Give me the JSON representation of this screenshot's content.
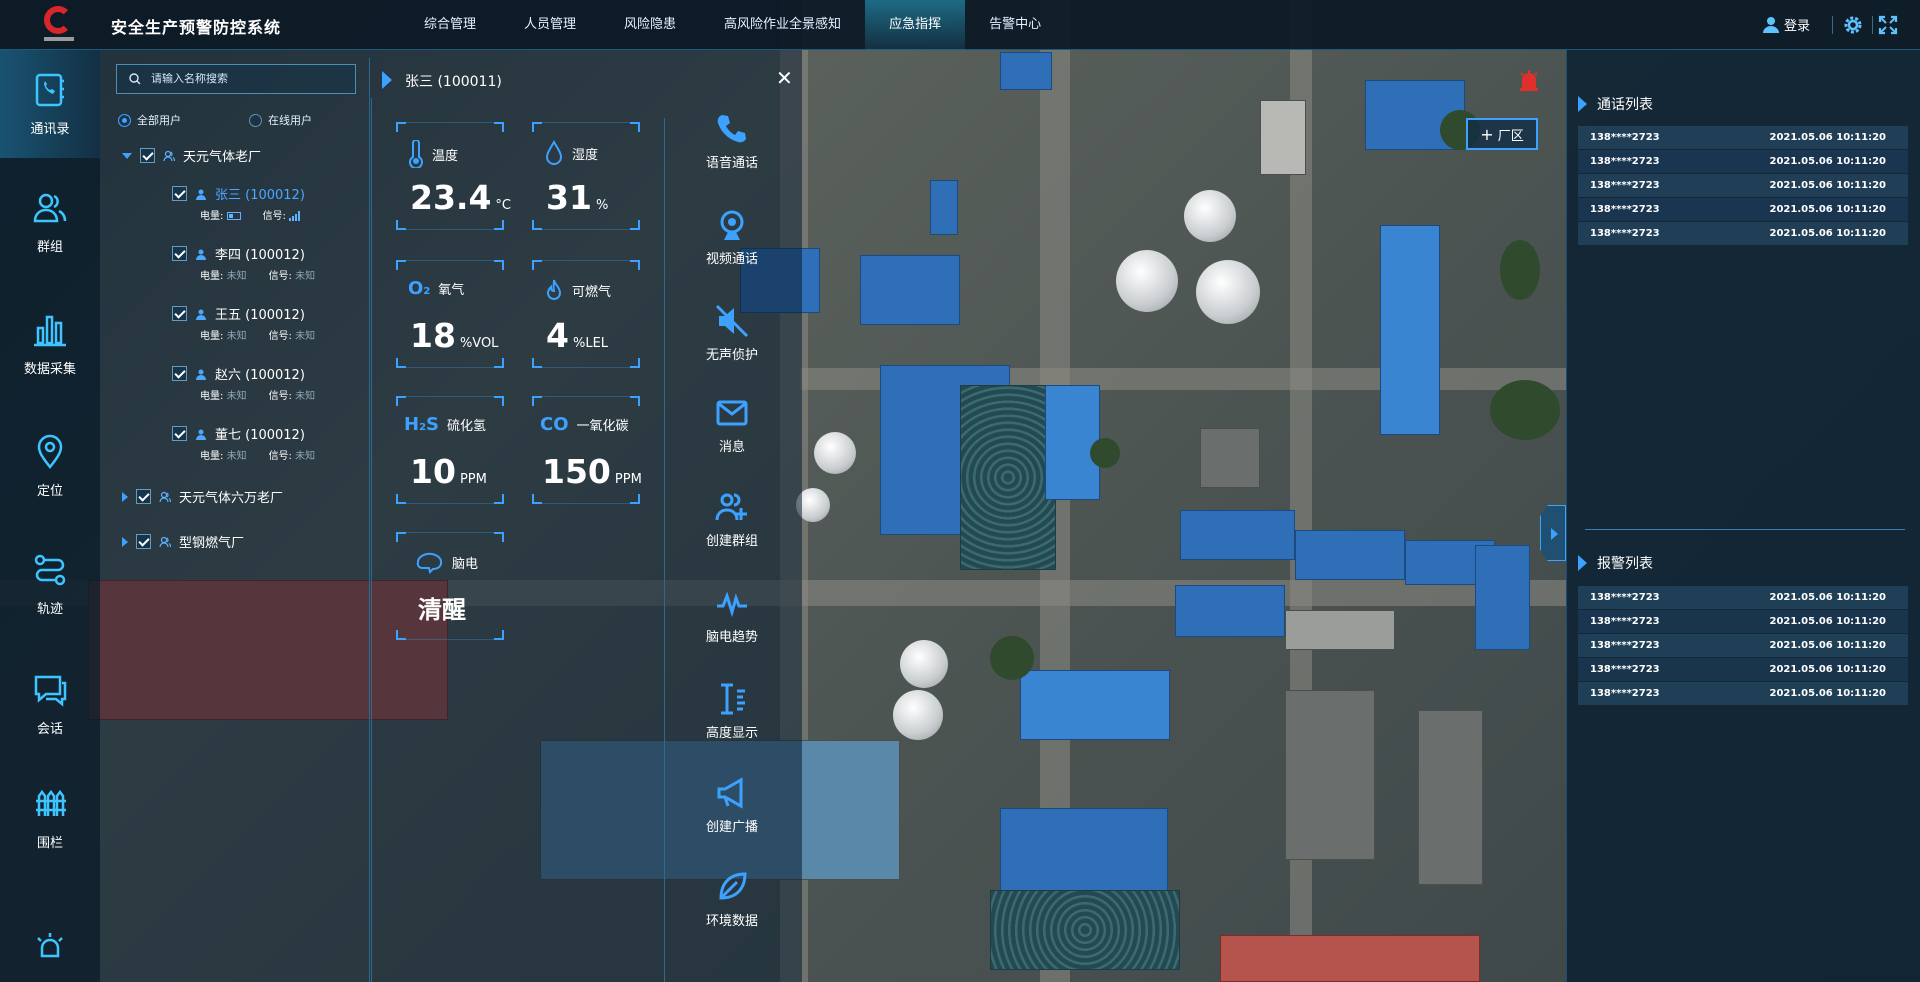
{
  "app": {
    "title": "安全生产预警防控系统"
  },
  "nav": [
    {
      "label": "综合管理"
    },
    {
      "label": "人员管理"
    },
    {
      "label": "风险隐患"
    },
    {
      "label": "高风险作业全景感知"
    },
    {
      "label": "应急指挥",
      "active": true
    },
    {
      "label": "告警中心"
    }
  ],
  "topright": {
    "login_label": "登录",
    "icons": [
      "user-icon",
      "gear-icon",
      "fullscreen-icon"
    ]
  },
  "sidebar": {
    "items": [
      {
        "label": "通讯录",
        "icon": "phonebook-icon",
        "active": true
      },
      {
        "label": "群组",
        "icon": "group-icon"
      },
      {
        "label": "数据采集",
        "icon": "bar-chart-icon"
      },
      {
        "label": "定位",
        "icon": "location-pin-icon"
      },
      {
        "label": "轨迹",
        "icon": "route-icon"
      },
      {
        "label": "会话",
        "icon": "chat-icon"
      },
      {
        "label": "围栏",
        "icon": "fence-icon"
      }
    ]
  },
  "tree": {
    "search_placeholder": "请输入名称搜索",
    "filters": [
      {
        "label": "全部用户",
        "selected": true
      },
      {
        "label": "在线用户",
        "selected": false
      }
    ],
    "battery_label": "电量:",
    "signal_label": "信号:",
    "unknown": "未知",
    "groups": [
      {
        "name": "天元气体老厂",
        "expanded": true
      },
      {
        "name": "天元气体六万老厂",
        "expanded": false
      },
      {
        "name": "型钢燃气厂",
        "expanded": false
      }
    ],
    "users": [
      {
        "name": "张三 (100012)",
        "selected": true
      },
      {
        "name": "李四 (100012)"
      },
      {
        "name": "王五 (100012)"
      },
      {
        "name": "赵六 (100012)"
      },
      {
        "name": "董七 (100012)"
      }
    ]
  },
  "detail": {
    "title": "张三 (100011)",
    "close": "✕",
    "metrics": {
      "temp": {
        "label": "温度",
        "value": "23.4",
        "unit": "°C"
      },
      "hum": {
        "label": "湿度",
        "value": "31",
        "unit": "%"
      },
      "o2": {
        "label": "氧气",
        "value": "18",
        "unit": "%VOL",
        "chem": "O2"
      },
      "gas": {
        "label": "可燃气",
        "value": "4",
        "unit": "%LEL"
      },
      "h2s": {
        "label": "硫化氢",
        "value": "10",
        "unit": "PPM",
        "chem": "H2S"
      },
      "co": {
        "label": "一氧化碳",
        "value": "150",
        "unit": "PPM",
        "chem": "CO"
      },
      "brain": {
        "label": "脑电",
        "value": "清醒"
      }
    },
    "actions": [
      {
        "label": "语音通话",
        "icon": "phone-icon"
      },
      {
        "label": "视频通话",
        "icon": "camera-icon"
      },
      {
        "label": "无声侦护",
        "icon": "mute-icon"
      },
      {
        "label": "消息",
        "icon": "envelope-icon"
      },
      {
        "label": "创建群组",
        "icon": "add-group-icon"
      },
      {
        "label": "脑电趋势",
        "icon": "wave-icon"
      },
      {
        "label": "高度显示",
        "icon": "height-icon"
      },
      {
        "label": "创建广播",
        "icon": "megaphone-icon"
      },
      {
        "label": "环境数据",
        "icon": "leaf-icon"
      }
    ]
  },
  "map": {
    "zone_button": "厂区",
    "zone_button_prefix": "+"
  },
  "call_list": {
    "title": "通话列表",
    "rows": [
      {
        "phone": "138****2723",
        "time": "2021.05.06  10:11:20"
      },
      {
        "phone": "138****2723",
        "time": "2021.05.06  10:11:20"
      },
      {
        "phone": "138****2723",
        "time": "2021.05.06  10:11:20"
      },
      {
        "phone": "138****2723",
        "time": "2021.05.06  10:11:20"
      },
      {
        "phone": "138****2723",
        "time": "2021.05.06  10:11:20"
      }
    ]
  },
  "alarm_list": {
    "title": "报警列表",
    "rows": [
      {
        "phone": "138****2723",
        "time": "2021.05.06  10:11:20"
      },
      {
        "phone": "138****2723",
        "time": "2021.05.06  10:11:20"
      },
      {
        "phone": "138****2723",
        "time": "2021.05.06  10:11:20"
      },
      {
        "phone": "138****2723",
        "time": "2021.05.06  10:11:20"
      },
      {
        "phone": "138****2723",
        "time": "2021.05.06  10:11:20"
      }
    ]
  },
  "colors": {
    "accent": "#3da2ff",
    "alarm": "#e0302b",
    "roof_blue": "#2f6fb8"
  }
}
